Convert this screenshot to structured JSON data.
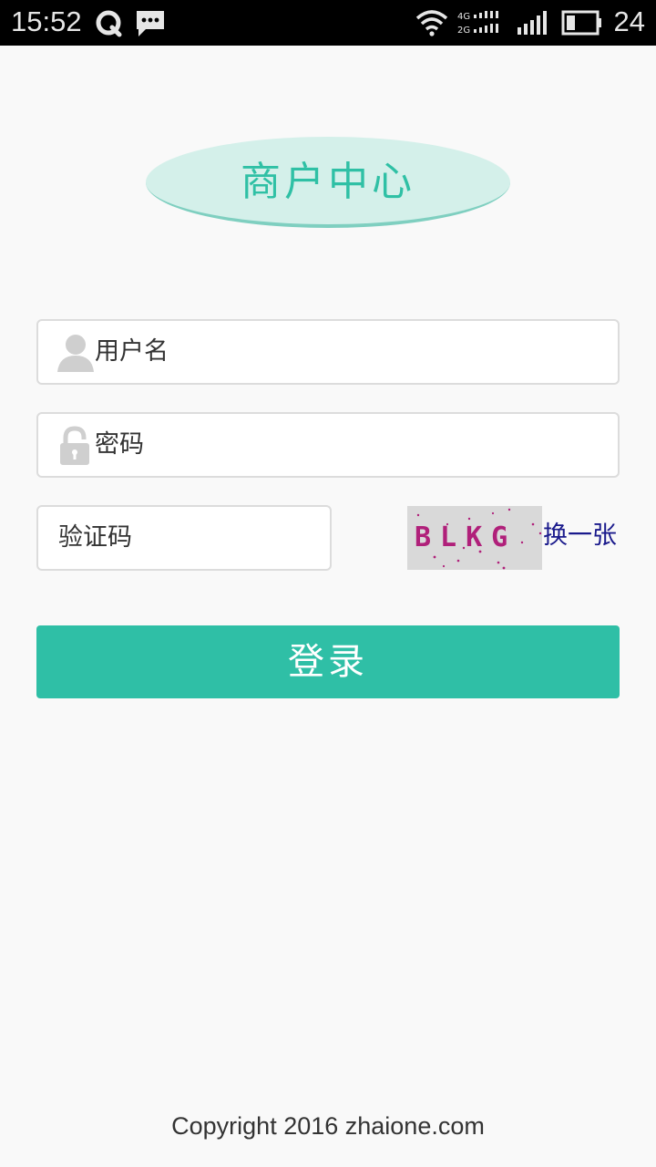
{
  "status_bar": {
    "time": "15:52",
    "battery": "24",
    "icons": [
      "q-app-icon",
      "message-icon",
      "wifi-icon",
      "network-4g-2g-icon",
      "signal-icon",
      "battery-icon"
    ]
  },
  "header": {
    "title": "商户中心"
  },
  "form": {
    "username_label": "用户名",
    "password_label": "密码",
    "captcha_label": "验证码",
    "captcha_text": "BLKG",
    "refresh_label": "换一张",
    "login_label": "登录"
  },
  "footer": {
    "copyright": "Copyright 2016 zhaione.com"
  },
  "colors": {
    "accent": "#2fbfa6",
    "title_bg": "#d4f0ea",
    "link": "#1a1a8c",
    "captcha_text": "#b0207a"
  }
}
